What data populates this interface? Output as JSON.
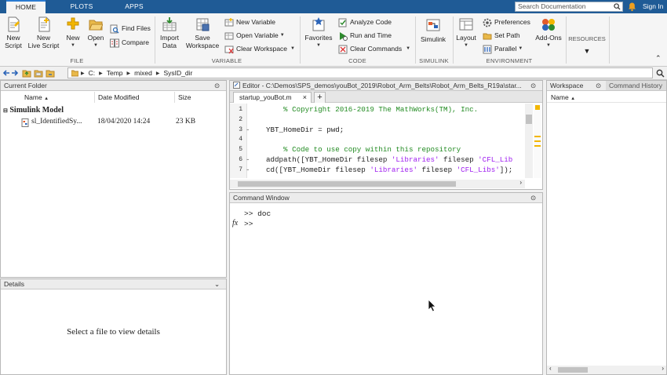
{
  "tabs": [
    {
      "label": "HOME",
      "active": true
    },
    {
      "label": "PLOTS",
      "active": false
    },
    {
      "label": "APPS",
      "active": false
    }
  ],
  "search": {
    "placeholder": "Search Documentation"
  },
  "signin_label": "Sign In",
  "ribbon": {
    "file": {
      "new_script": [
        "New",
        "Script"
      ],
      "new_live_script": [
        "New",
        "Live Script"
      ],
      "new": "New",
      "open": "Open",
      "find_files": "Find Files",
      "compare": "Compare",
      "label": "FILE"
    },
    "variable": {
      "import_data": [
        "Import",
        "Data"
      ],
      "save_workspace": [
        "Save",
        "Workspace"
      ],
      "new_variable": "New Variable",
      "open_variable": "Open Variable",
      "clear_workspace": "Clear Workspace",
      "label": "VARIABLE"
    },
    "code": {
      "favorites": "Favorites",
      "analyze_code": "Analyze Code",
      "run_and_time": "Run and Time",
      "clear_commands": "Clear Commands",
      "label": "CODE"
    },
    "simulink": {
      "simulink": "Simulink",
      "label": "SIMULINK"
    },
    "environment": {
      "layout": "Layout",
      "preferences": "Preferences",
      "set_path": "Set Path",
      "parallel": "Parallel",
      "add_ons": "Add-Ons",
      "label": "ENVIRONMENT"
    },
    "resources": {
      "label": "RESOURCES"
    }
  },
  "address": {
    "path": [
      "C:",
      "Temp",
      "mixed",
      "SysID_dir"
    ]
  },
  "current_folder": {
    "title": "Current Folder",
    "columns": {
      "name": "Name",
      "date": "Date Modified",
      "size": "Size"
    },
    "group": "Simulink Model",
    "files": [
      {
        "name": "sl_IdentifiedSy...",
        "date": "18/04/2020 14:24",
        "size": "23 KB"
      }
    ]
  },
  "details": {
    "title": "Details",
    "message": "Select a file to view details"
  },
  "editor": {
    "title": "Editor - C:\\Demos\\SPS_demos\\youBot_2019\\Robot_Arm_Belts\\Robot_Arm_Belts_R19a\\star...",
    "tab": "startup_youBot.m",
    "lines": [
      {
        "num": "1",
        "mark": "",
        "parts": [
          {
            "t": "    % Copyright 2016-2019 The MathWorks(TM), Inc.",
            "c": "cmt"
          }
        ]
      },
      {
        "num": "2",
        "mark": "",
        "parts": []
      },
      {
        "num": "3",
        "mark": "-",
        "parts": [
          {
            "t": "YBT_HomeDir = pwd;",
            "c": ""
          }
        ]
      },
      {
        "num": "4",
        "mark": "",
        "parts": []
      },
      {
        "num": "5",
        "mark": "",
        "parts": [
          {
            "t": "    % Code to use copy within this repository",
            "c": "cmt"
          }
        ]
      },
      {
        "num": "6",
        "mark": "-",
        "parts": [
          {
            "t": "addpath([YBT_HomeDir filesep ",
            "c": ""
          },
          {
            "t": "'Libraries'",
            "c": "str"
          },
          {
            "t": " filesep ",
            "c": ""
          },
          {
            "t": "'CFL_Lib",
            "c": "str"
          }
        ]
      },
      {
        "num": "7",
        "mark": "-",
        "parts": [
          {
            "t": "cd([YBT_HomeDir filesep ",
            "c": ""
          },
          {
            "t": "'Libraries'",
            "c": "str"
          },
          {
            "t": " filesep ",
            "c": ""
          },
          {
            "t": "'CFL_Libs'",
            "c": "str"
          },
          {
            "t": "]);",
            "c": ""
          }
        ]
      }
    ]
  },
  "command_window": {
    "title": "Command Window",
    "lines": [
      ">> doc",
      ">>"
    ],
    "fx_label": "fx"
  },
  "workspace": {
    "title": "Workspace",
    "history_tab": "Command History",
    "column": "Name"
  },
  "colors": {
    "titlebar": "#1f5b96",
    "ribbon_bg": "#f5f5f5",
    "comment": "#228b22",
    "string": "#a020f0"
  }
}
